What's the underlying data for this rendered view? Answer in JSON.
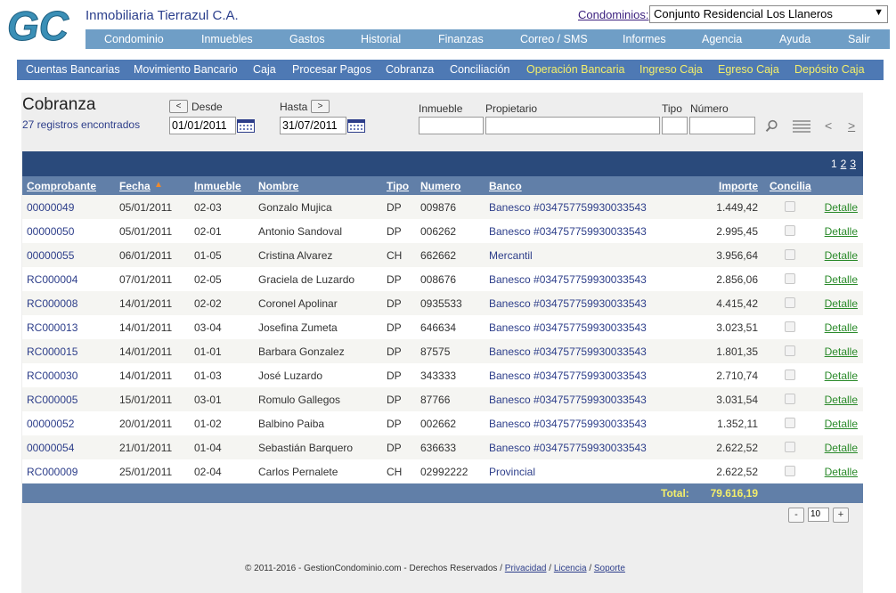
{
  "header": {
    "logo_text": "GC",
    "company": "Inmobiliaria Tierrazul C.A.",
    "condo_label": "Condominios:",
    "condo_selected": "Conjunto Residencial Los Llaneros"
  },
  "topnav": [
    "Condominio",
    "Inmuebles",
    "Gastos",
    "Historial",
    "Finanzas",
    "Correo / SMS",
    "Informes",
    "Agencia",
    "Ayuda",
    "Salir"
  ],
  "subnav": [
    {
      "label": "Cuentas Bancarias",
      "highlight": false
    },
    {
      "label": "Movimiento Bancario",
      "highlight": false
    },
    {
      "label": "Caja",
      "highlight": false
    },
    {
      "label": "Procesar Pagos",
      "highlight": false
    },
    {
      "label": "Cobranza",
      "highlight": false
    },
    {
      "label": "Conciliación",
      "highlight": false
    },
    {
      "label": "Operación Bancaria",
      "highlight": true
    },
    {
      "label": "Ingreso Caja",
      "highlight": true
    },
    {
      "label": "Egreso Caja",
      "highlight": true
    },
    {
      "label": "Depósito Caja",
      "highlight": true
    }
  ],
  "page": {
    "title": "Cobranza",
    "record_count": "27 registros encontrados"
  },
  "filters": {
    "prev": "<",
    "next": ">",
    "desde_label": "Desde",
    "desde_value": "01/01/2011",
    "hasta_label": "Hasta",
    "hasta_value": "31/07/2011",
    "inmueble_label": "Inmueble",
    "inmueble_value": "",
    "propietario_label": "Propietario",
    "propietario_value": "",
    "tipo_label": "Tipo",
    "tipo_value": "",
    "numero_label": "Número",
    "numero_value": "",
    "nav_prev": "<",
    "nav_next": ">"
  },
  "pager": {
    "current": "1",
    "pages": [
      "2",
      "3"
    ]
  },
  "table": {
    "columns": {
      "comprobante": "Comprobante",
      "fecha": "Fecha",
      "inmueble": "Inmueble",
      "nombre": "Nombre",
      "tipo": "Tipo",
      "numero": "Numero",
      "banco": "Banco",
      "importe": "Importe",
      "concilia": "Concilia"
    },
    "detail_label": "Detalle",
    "rows": [
      {
        "comprobante": "00000049",
        "fecha": "05/01/2011",
        "inmueble": "02-03",
        "nombre": "Gonzalo Mujica",
        "tipo": "DP",
        "numero": "009876",
        "banco": "Banesco #034757759930033543",
        "importe": "1.449,42"
      },
      {
        "comprobante": "00000050",
        "fecha": "05/01/2011",
        "inmueble": "02-01",
        "nombre": "Antonio Sandoval",
        "tipo": "DP",
        "numero": "006262",
        "banco": "Banesco #034757759930033543",
        "importe": "2.995,45"
      },
      {
        "comprobante": "00000055",
        "fecha": "06/01/2011",
        "inmueble": "01-05",
        "nombre": "Cristina Alvarez",
        "tipo": "CH",
        "numero": "662662",
        "banco": "Mercantil",
        "importe": "3.956,64"
      },
      {
        "comprobante": "RC000004",
        "fecha": "07/01/2011",
        "inmueble": "02-05",
        "nombre": "Graciela de Luzardo",
        "tipo": "DP",
        "numero": "008676",
        "banco": "Banesco #034757759930033543",
        "importe": "2.856,06"
      },
      {
        "comprobante": "RC000008",
        "fecha": "14/01/2011",
        "inmueble": "02-02",
        "nombre": "Coronel Apolinar",
        "tipo": "DP",
        "numero": "0935533",
        "banco": "Banesco #034757759930033543",
        "importe": "4.415,42"
      },
      {
        "comprobante": "RC000013",
        "fecha": "14/01/2011",
        "inmueble": "03-04",
        "nombre": "Josefina Zumeta",
        "tipo": "DP",
        "numero": "646634",
        "banco": "Banesco #034757759930033543",
        "importe": "3.023,51"
      },
      {
        "comprobante": "RC000015",
        "fecha": "14/01/2011",
        "inmueble": "01-01",
        "nombre": "Barbara Gonzalez",
        "tipo": "DP",
        "numero": "87575",
        "banco": "Banesco #034757759930033543",
        "importe": "1.801,35"
      },
      {
        "comprobante": "RC000030",
        "fecha": "14/01/2011",
        "inmueble": "01-03",
        "nombre": "José Luzardo",
        "tipo": "DP",
        "numero": "343333",
        "banco": "Banesco #034757759930033543",
        "importe": "2.710,74"
      },
      {
        "comprobante": "RC000005",
        "fecha": "15/01/2011",
        "inmueble": "03-01",
        "nombre": "Romulo Gallegos",
        "tipo": "DP",
        "numero": "87766",
        "banco": "Banesco #034757759930033543",
        "importe": "3.031,54"
      },
      {
        "comprobante": "00000052",
        "fecha": "20/01/2011",
        "inmueble": "01-02",
        "nombre": "Balbino Paiba",
        "tipo": "DP",
        "numero": "002662",
        "banco": "Banesco #034757759930033543",
        "importe": "1.352,11"
      },
      {
        "comprobante": "00000054",
        "fecha": "21/01/2011",
        "inmueble": "01-04",
        "nombre": "Sebastián Barquero",
        "tipo": "DP",
        "numero": "636633",
        "banco": "Banesco #034757759930033543",
        "importe": "2.622,52"
      },
      {
        "comprobante": "RC000009",
        "fecha": "25/01/2011",
        "inmueble": "02-04",
        "nombre": "Carlos Pernalete",
        "tipo": "CH",
        "numero": "02992222",
        "banco": "Provincial",
        "importe": "2.622,52"
      }
    ],
    "total_label": "Total:",
    "total_value": "79.616,19"
  },
  "per_page": {
    "minus": "-",
    "value": "10",
    "plus": "+"
  },
  "footer": {
    "text": "© 2011-2016 - GestionCondominio.com - Derechos Reservados /",
    "privacidad": "Privacidad",
    "licencia": "Licencia",
    "soporte": "Soporte",
    "sep": "/"
  },
  "colors": {
    "top_nav": "#6f9ec6",
    "sub_nav": "#4e79b4",
    "table_header": "#617fa8",
    "pager_bar": "#2a4a7b",
    "highlight_text": "#f4ef6a",
    "detail_link": "#2a8a2a"
  },
  "icons": {
    "calendar": "calendar-icon",
    "search": "search-icon",
    "list": "list-icon",
    "sort": "sort-up-icon",
    "dropdown": "chevron-down-icon"
  }
}
